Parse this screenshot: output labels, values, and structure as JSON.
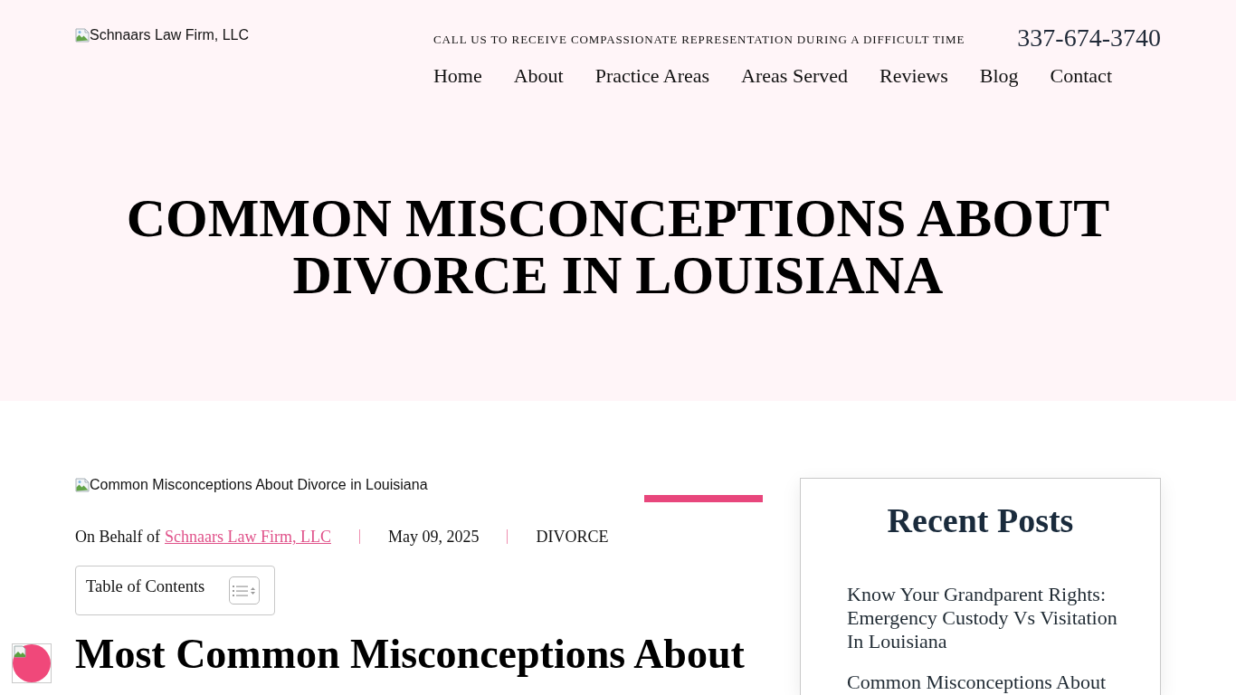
{
  "header": {
    "logo": {
      "alt_text": "Schnaars Law Firm, LLC"
    },
    "tagline": "CALL US TO RECEIVE COMPASSIONATE REPRESENTATION DURING A DIFFICULT TIME",
    "phone": "337-674-3740",
    "nav": [
      {
        "label": "Home"
      },
      {
        "label": "About"
      },
      {
        "label": "Practice Areas"
      },
      {
        "label": "Areas Served"
      },
      {
        "label": "Reviews"
      },
      {
        "label": "Blog"
      },
      {
        "label": "Contact"
      }
    ]
  },
  "hero": {
    "title": "COMMON MISCONCEPTIONS ABOUT DIVORCE IN LOUISIANA"
  },
  "article": {
    "featured_image": {
      "alt_text": "Common Misconceptions About Divorce in Louisiana"
    },
    "meta": {
      "prefix": "On Behalf of",
      "author": "Schnaars Law Firm, LLC",
      "date": "May 09, 2025",
      "category": "DIVORCE"
    },
    "toc": {
      "title": "Table of Contents"
    },
    "heading": "Most Common Misconceptions About"
  },
  "sidebar": {
    "title": "Recent Posts",
    "posts": [
      {
        "title": "Know Your Grandparent Rights: Emergency Custody Vs Visitation In Louisiana"
      },
      {
        "title": "Common Misconceptions About"
      }
    ]
  }
}
